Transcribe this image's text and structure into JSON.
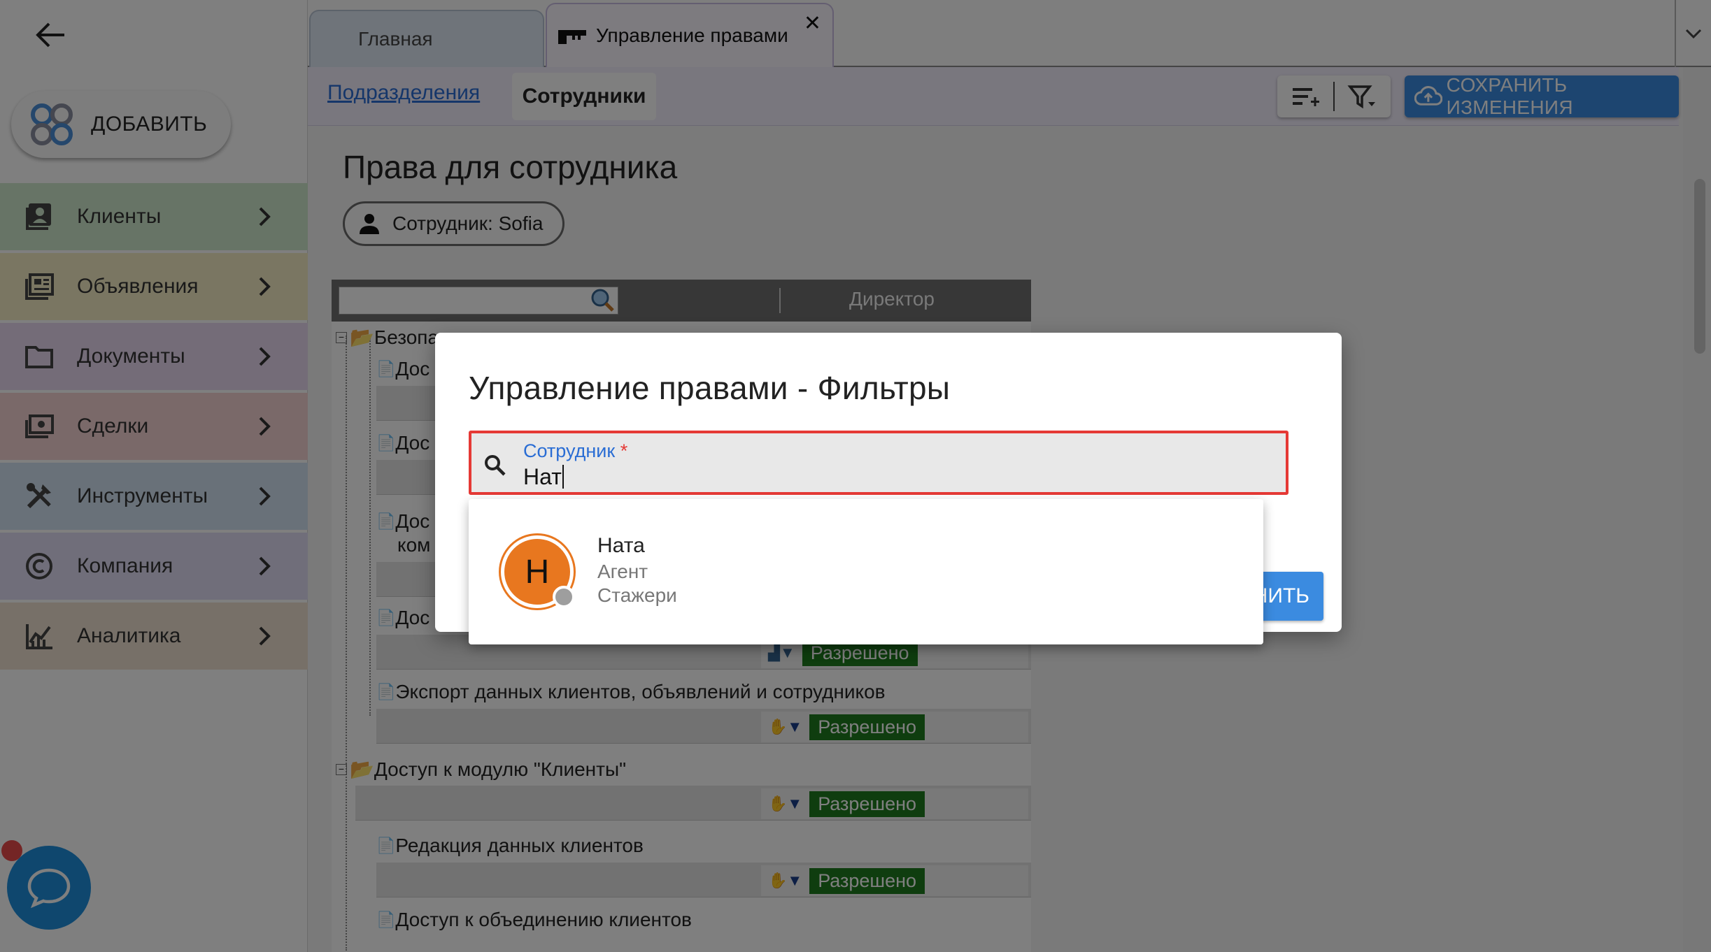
{
  "tabs": [
    {
      "label": "Главная",
      "active": false
    },
    {
      "label": "Управление правами",
      "active": true,
      "close": "✕"
    }
  ],
  "sidebar": {
    "add_label": "ДОБАВИТЬ",
    "items": [
      {
        "label": "Клиенты",
        "icon": "contacts-icon",
        "color": "#cfe9cc"
      },
      {
        "label": "Объявления",
        "icon": "listing-icon",
        "color": "#f5ecc5"
      },
      {
        "label": "Документы",
        "icon": "folder-icon",
        "color": "#e8d9f0"
      },
      {
        "label": "Сделки",
        "icon": "money-icon",
        "color": "#f4d2d2"
      },
      {
        "label": "Инструменты",
        "icon": "tools-icon",
        "color": "#d2e2f2"
      },
      {
        "label": "Компания",
        "icon": "copyright-icon",
        "color": "#e0dcf4"
      },
      {
        "label": "Аналитика",
        "icon": "analytics-icon",
        "color": "#efe0d0"
      }
    ]
  },
  "subbar": {
    "link": "Подразделения",
    "active_tab": "Сотрудники",
    "save_label": "СОХРАНИТЬ ИЗМЕНЕНИЯ"
  },
  "main": {
    "title": "Права для сотрудника",
    "chip": "Сотрудник: Sofia",
    "tree": {
      "column_header": "Директор",
      "rows": [
        {
          "label": "Безопа",
          "type": "folder"
        },
        {
          "label": "Дос",
          "type": "doc"
        },
        {
          "label": "Дос",
          "type": "doc"
        },
        {
          "label": "Дос",
          "type": "doc"
        },
        {
          "label": "ком",
          "type": "text"
        },
        {
          "label": "Дос",
          "type": "doc"
        },
        {
          "label": "Экспорт данных клиентов, объявлений и сотрудников",
          "type": "doc"
        },
        {
          "label": "Доступ к модулю \"Клиенты\"",
          "type": "folder"
        },
        {
          "label": "Редакция данных клиентов",
          "type": "doc"
        },
        {
          "label": "Доступ к объединению клиентов",
          "type": "doc"
        }
      ],
      "permission": "Разрешено"
    }
  },
  "dialog": {
    "title": "Управление правами - Фильтры",
    "field_label": "Сотрудник",
    "required_mark": "*",
    "field_value": "Нат",
    "button_label": "НИТЬ"
  },
  "suggestions": [
    {
      "initial": "Н",
      "name": "Ната",
      "role": "Агент",
      "department": "Стажери",
      "avatar_color": "#e8771f"
    }
  ]
}
